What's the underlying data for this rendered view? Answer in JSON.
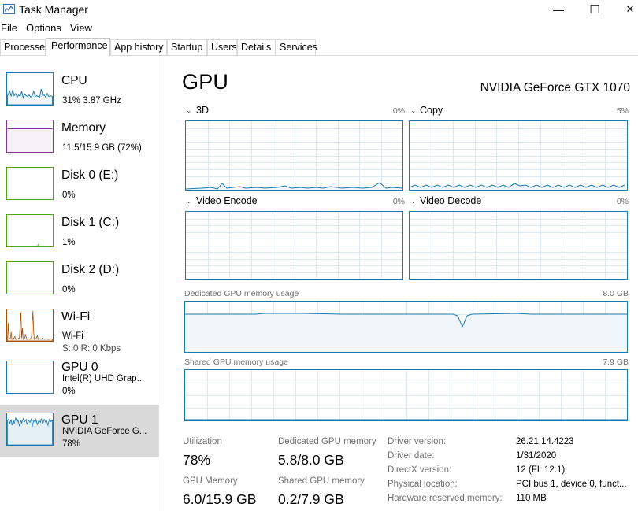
{
  "window": {
    "title": "Task Manager",
    "icon": "task-manager-icon",
    "minimize": "—",
    "maximize": "☐",
    "close": "✕"
  },
  "menu": [
    "File",
    "Options",
    "View"
  ],
  "tabs": [
    "Processes",
    "Performance",
    "App history",
    "Startup",
    "Users",
    "Details",
    "Services"
  ],
  "active_tab": "Performance",
  "sidebar": [
    {
      "name": "CPU",
      "line1": "31%  3.87 GHz",
      "line2": "",
      "line3": "",
      "color": "#1979ae"
    },
    {
      "name": "Memory",
      "line1": "11.5/15.9 GB (72%)",
      "line2": "",
      "line3": "",
      "color": "#8b2fa0"
    },
    {
      "name": "Disk 0 (E:)",
      "line1": "0%",
      "line2": "",
      "line3": "",
      "color": "#4da60c"
    },
    {
      "name": "Disk 1 (C:)",
      "line1": "1%",
      "line2": "",
      "line3": "",
      "color": "#4da60c"
    },
    {
      "name": "Disk 2 (D:)",
      "line1": "0%",
      "line2": "",
      "line3": "",
      "color": "#4da60c"
    },
    {
      "name": "Wi-Fi",
      "line1": "Wi-Fi",
      "line2": "S: 0  R: 0 Kbps",
      "line3": "",
      "color": "#a74f01"
    },
    {
      "name": "GPU 0",
      "line1": "Intel(R) UHD Grap...",
      "line2": "0%",
      "line3": "",
      "color": "#1979ae"
    },
    {
      "name": "GPU 1",
      "line1": "NVIDIA GeForce G...",
      "line2": "78%",
      "line3": "",
      "color": "#1979ae"
    }
  ],
  "selected_index": 7,
  "main": {
    "heading": "GPU",
    "model": "NVIDIA GeForce GTX 1070",
    "engines": [
      {
        "name": "3D",
        "pct": "0%"
      },
      {
        "name": "Copy",
        "pct": "5%"
      },
      {
        "name": "Video Encode",
        "pct": "0%"
      },
      {
        "name": "Video Decode",
        "pct": "0%"
      }
    ],
    "dedicated_label": "Dedicated GPU memory usage",
    "dedicated_max": "8.0 GB",
    "shared_label": "Shared GPU memory usage",
    "shared_max": "7.9 GB",
    "stats": [
      {
        "label": "Utilization",
        "value": "78%"
      },
      {
        "label": "Dedicated GPU memory",
        "value": "5.8/8.0 GB"
      },
      {
        "label": "GPU Memory",
        "value": "6.0/15.9 GB"
      },
      {
        "label": "Shared GPU memory",
        "value": "0.2/7.9 GB"
      }
    ],
    "info": [
      {
        "k": "Driver version:",
        "v": "26.21.14.4223"
      },
      {
        "k": "Driver date:",
        "v": "1/31/2020"
      },
      {
        "k": "DirectX version:",
        "v": "12 (FL 12.1)"
      },
      {
        "k": "Physical location:",
        "v": "PCI bus 1, device 0, funct..."
      },
      {
        "k": "Hardware reserved memory:",
        "v": "110 MB"
      }
    ]
  },
  "colors": {
    "gpu_line": "#1979ae",
    "gpu_fill": "#f1f6fa",
    "grid": "#d9eaf4",
    "selected_bg": "#d9d9d9"
  }
}
